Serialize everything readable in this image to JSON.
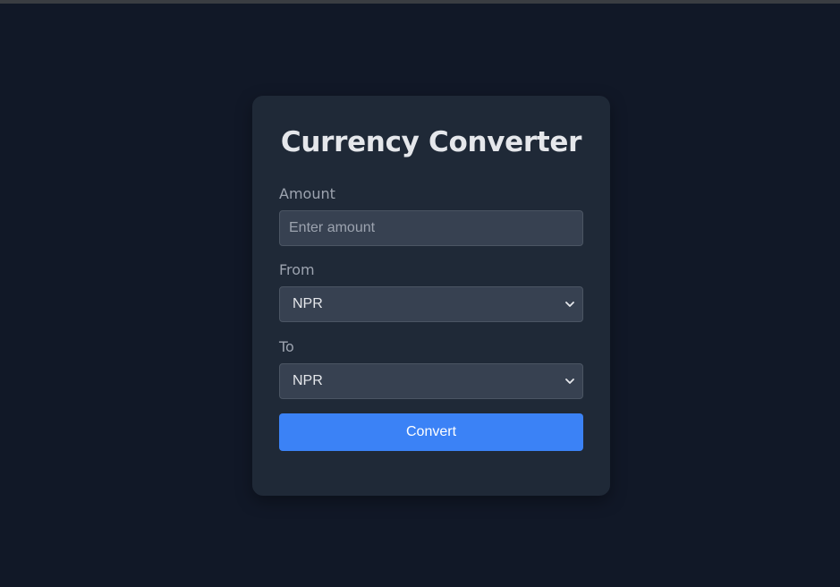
{
  "app": {
    "title": "Currency Converter"
  },
  "form": {
    "amount": {
      "label": "Amount",
      "placeholder": "Enter amount",
      "value": ""
    },
    "from": {
      "label": "From",
      "selected": "NPR"
    },
    "to": {
      "label": "To",
      "selected": "NPR"
    },
    "convert_label": "Convert"
  },
  "icons": {
    "select_chevron": "chevron-down-icon"
  },
  "colors": {
    "background": "#111827",
    "card": "#1f2937",
    "field": "#374151",
    "accent": "#3b82f6",
    "title": "#e5e7eb",
    "label": "#9ca3af"
  }
}
